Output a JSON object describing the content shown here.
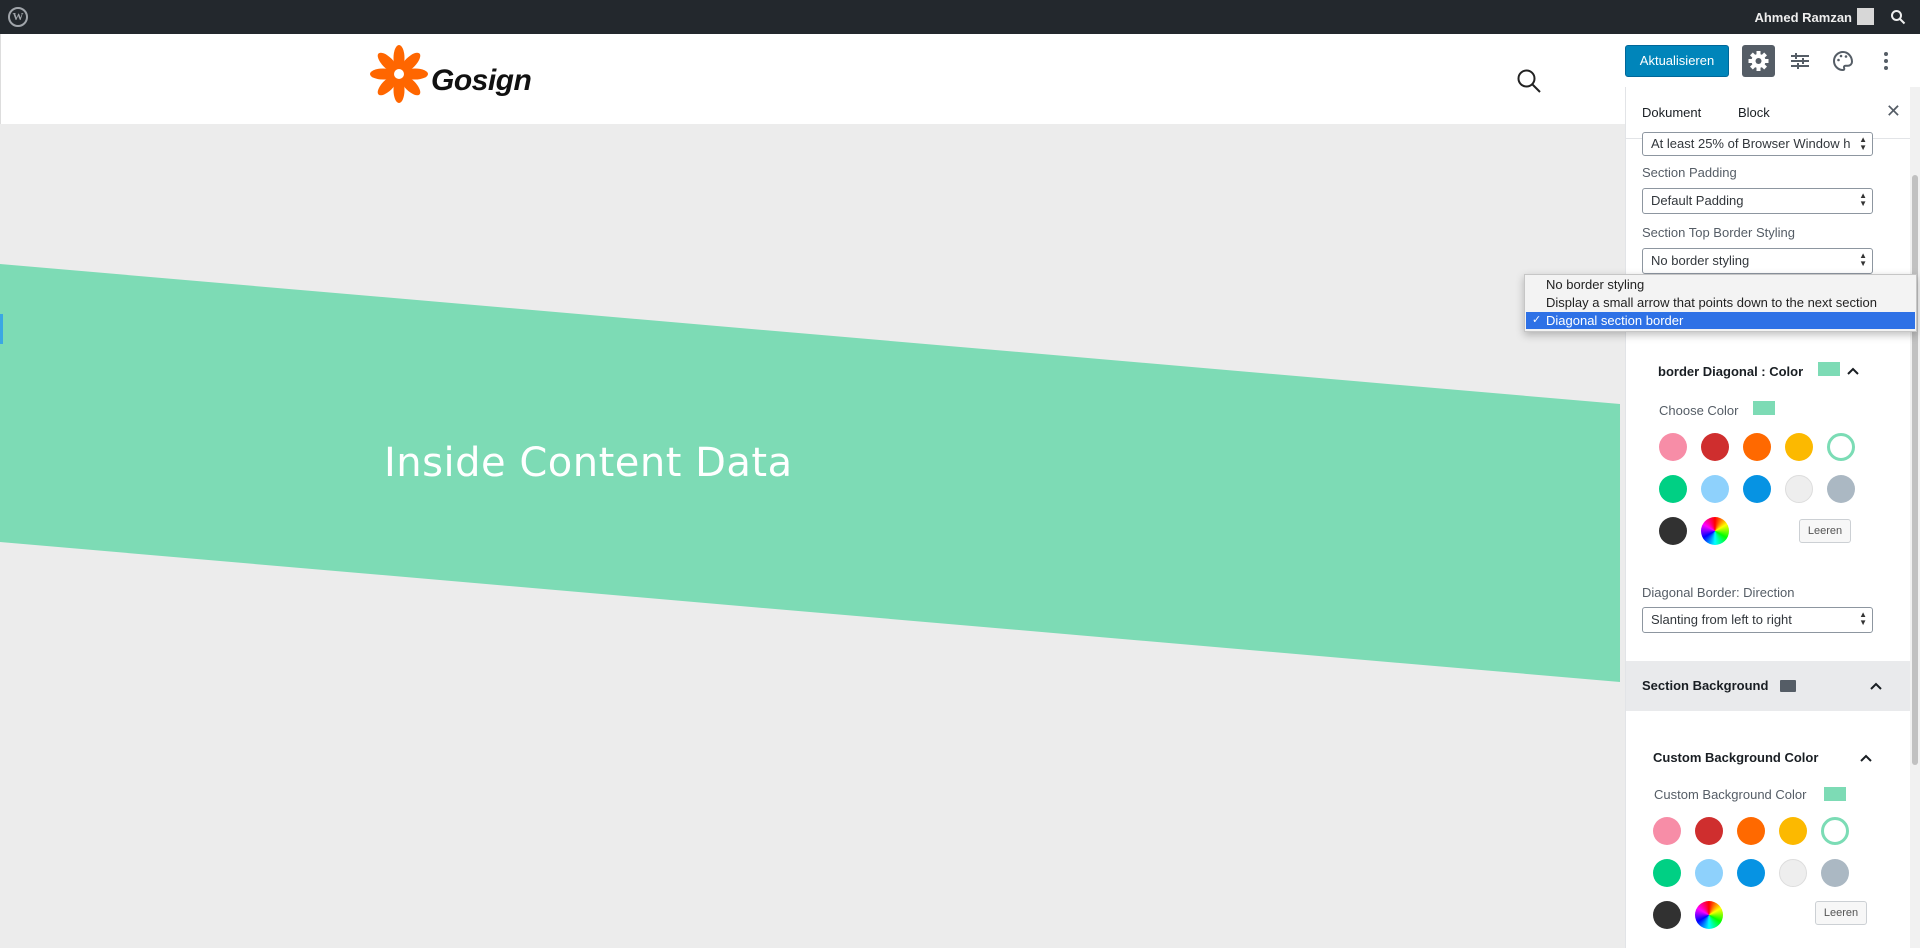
{
  "admin_bar": {
    "wp_logo": "W",
    "user_name": "Ahmed Ramzan"
  },
  "site": {
    "logo_text": "Gosign",
    "logo_color": "#ff6600"
  },
  "toolbar": {
    "update_label": "Aktualisieren",
    "icons": [
      "gear-icon",
      "sliders-icon",
      "palette-icon",
      "more-vertical-icon"
    ]
  },
  "content": {
    "band_title": "Inside Content Data",
    "band_color": "#7ddbb5"
  },
  "sidebar": {
    "tabs": {
      "document": "Dokument",
      "block": "Block"
    },
    "min_height_value": "At least 25% of Browser Window h",
    "section_padding": {
      "label": "Section Padding",
      "value": "Default Padding"
    },
    "top_border": {
      "label": "Section Top Border Styling",
      "value": "No border styling"
    },
    "border_color_panel": {
      "title": "border Diagonal : Color",
      "choose_label": "Choose Color",
      "clear_label": "Leeren"
    },
    "direction": {
      "label": "Diagonal Border: Direction",
      "value": "Slanting from left to right"
    },
    "section_background": {
      "title": "Section Background"
    },
    "custom_bg": {
      "title": "Custom Background Color",
      "label": "Custom Background Color",
      "clear_label": "Leeren"
    },
    "palette": [
      "#f78da7",
      "#cf2e2e",
      "#ff6900",
      "#fcb900",
      "#7bdcb5",
      "#00d084",
      "#8ed1fc",
      "#0693e3",
      "#eeeeee",
      "#abb8c3",
      "#313131",
      "gradient"
    ]
  },
  "dropdown": {
    "options": [
      "No border styling",
      "Display a small arrow that points down to the next section",
      "Diagonal section border"
    ],
    "selected_index": 2
  }
}
